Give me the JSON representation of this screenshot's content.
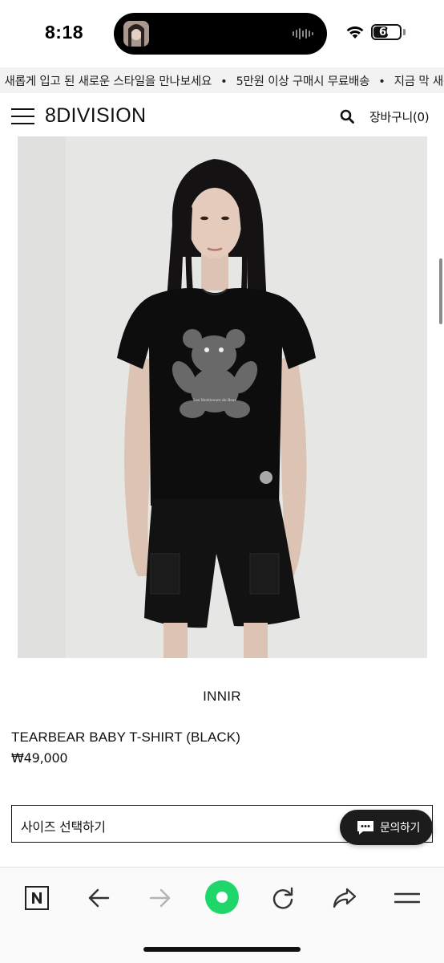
{
  "status_bar": {
    "time": "8:18",
    "battery_level": "60",
    "battery_fraction": 0.6
  },
  "promo_banner": {
    "items": [
      "이 새롭게 입고 된 새로운 스타일을 만나보세요",
      "5만원 이상 구매시 무료배송",
      "지금 막 새롭"
    ],
    "separator": "•"
  },
  "header": {
    "logo": "8DIVISION",
    "cart_label": "장바구니(0)"
  },
  "product": {
    "brand": "INNIR",
    "name": "TEARBEAR BABY T-SHIRT (BLACK)",
    "price": "₩49,000",
    "tee_print_text": "Les Mottiveurs de Bear",
    "size_select_placeholder": "사이즈 선택하기"
  },
  "floating": {
    "inquiry_label": "문의하기"
  },
  "colors": {
    "accent_green": "#1fd66a",
    "banner_bg": "#f2f2f2",
    "text": "#111111"
  },
  "icons": {
    "menu": "hamburger-menu-icon",
    "search": "search-icon",
    "naver": "naver-logo-icon",
    "back": "arrow-left-icon",
    "forward": "arrow-right-icon",
    "green_dot": "green-dot-icon",
    "reload": "reload-icon",
    "share": "share-icon",
    "more": "menu-icon",
    "chat": "chat-bubble-icon"
  }
}
